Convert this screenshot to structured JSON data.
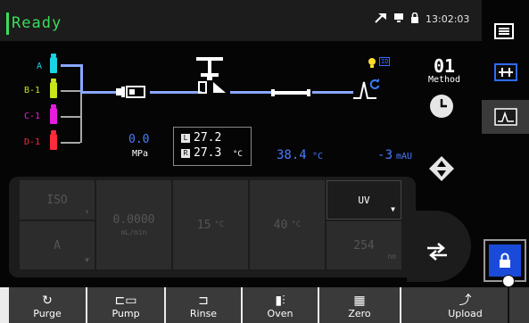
{
  "status": {
    "text": "Ready",
    "time": "13:02:03",
    "color": "#3cdc5a"
  },
  "solvents": [
    {
      "label": "A",
      "color": "#19d4e4"
    },
    {
      "label": "B-1",
      "color": "#c8e41a"
    },
    {
      "label": "C-1",
      "color": "#e81ce0"
    },
    {
      "label": "D-1",
      "color": "#ff2a3c"
    }
  ],
  "method": {
    "number": "01",
    "label": "Method"
  },
  "readouts": {
    "pressure_value": "0.0",
    "pressure_unit": "MPa",
    "oven_l": "27.2",
    "oven_r": "27.3",
    "oven_l_tag": "L",
    "oven_r_tag": "R",
    "oven_unit": "°C",
    "column_temp": "38.4",
    "column_temp_unit": "°C",
    "detector_value": "-3",
    "detector_unit": "mAU",
    "detector_badge": "ID"
  },
  "controls": {
    "mode": "ISO",
    "solvent": "A",
    "flow_value": "0.0000",
    "flow_unit": "mL/min",
    "temp1_value": "15",
    "temp1_unit": "°C",
    "temp2_value": "40",
    "temp2_unit": "°C",
    "detector_type": "UV",
    "wavelength_value": "254",
    "wavelength_unit": "nm"
  },
  "bottom_buttons": [
    {
      "label": "Purge",
      "icon": "↻"
    },
    {
      "label": "Pump",
      "icon": "⊏▭"
    },
    {
      "label": "Rinse",
      "icon": "⊐"
    },
    {
      "label": "Oven",
      "icon": "▮⫶"
    },
    {
      "label": "Zero",
      "icon": "▦"
    },
    {
      "label": "Upload",
      "icon": "⤴"
    }
  ]
}
